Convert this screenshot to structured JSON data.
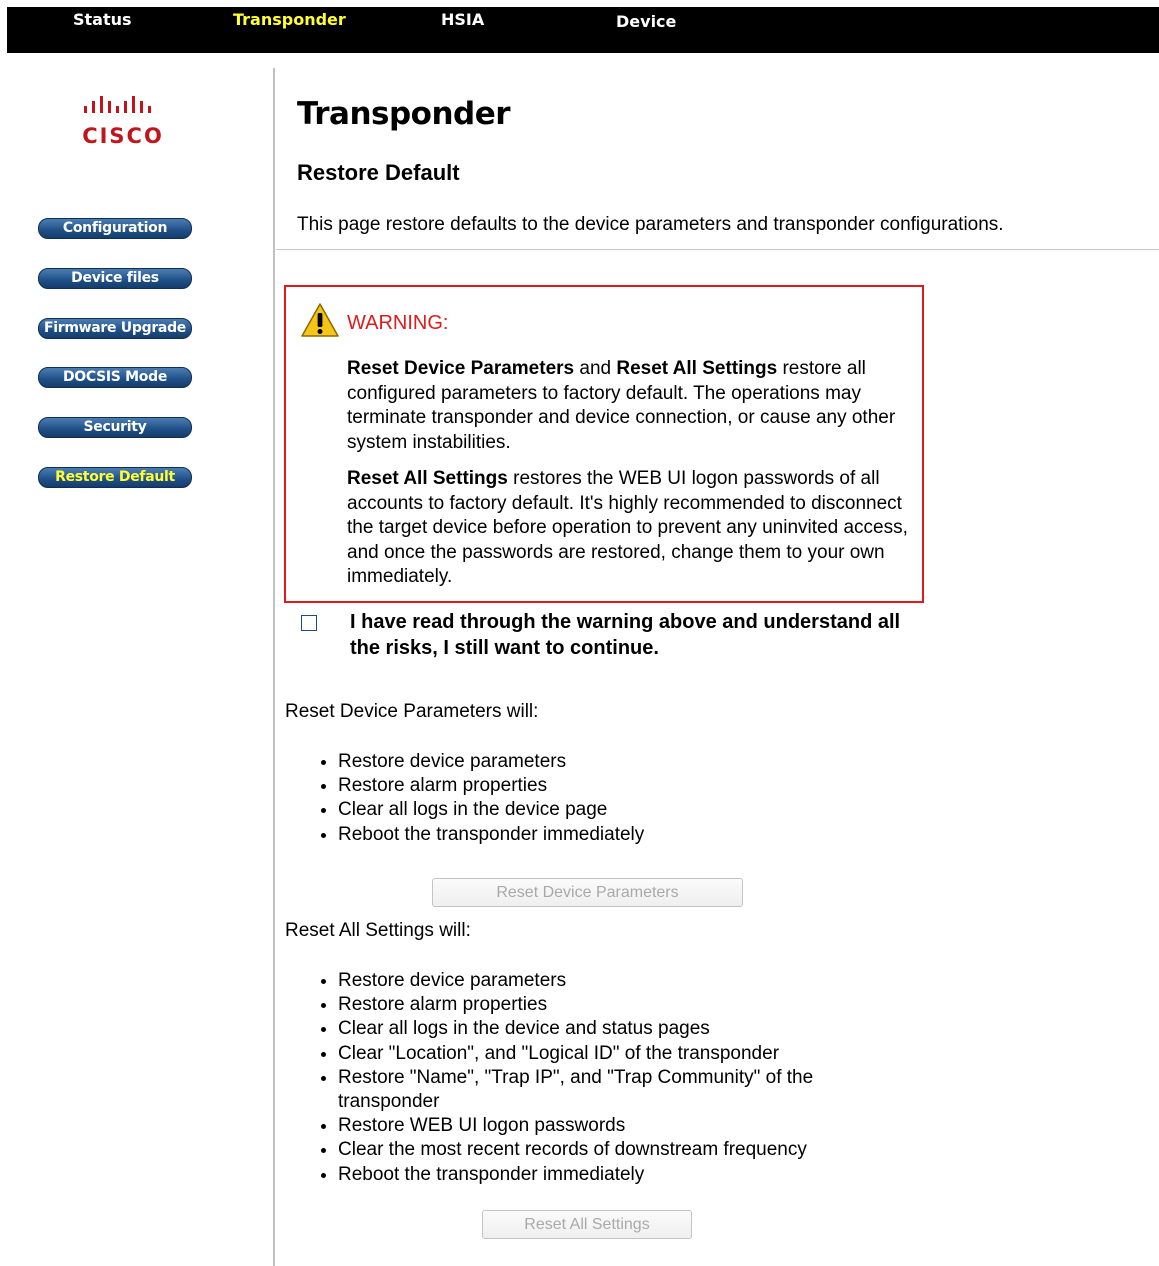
{
  "nav": {
    "items": [
      "Status",
      "Transponder",
      "HSIA",
      "Device"
    ],
    "active": "Transponder"
  },
  "logo": {
    "word": "CISCO"
  },
  "sidebar": {
    "items": [
      "Configuration",
      "Device files",
      "Firmware Upgrade",
      "DOCSIS Mode",
      "Security",
      "Restore Default"
    ],
    "active": "Restore Default"
  },
  "page": {
    "title": "Transponder",
    "subtitle": "Restore Default",
    "description": "This page restore defaults to the device parameters and transponder configurations."
  },
  "warning": {
    "title": "WARNING:",
    "p1_bold_a": "Reset Device Parameters",
    "p1_and": " and ",
    "p1_bold_b": "Reset All Settings",
    "p1_rest": " restore all configured parameters to factory default. The operations may terminate transponder and device connection, or cause any other system instabilities.",
    "p2_bold": "Reset All Settings",
    "p2_rest": " restores the WEB UI logon passwords of all accounts to factory default. It's highly recommended to disconnect the target device before operation to prevent any uninvited access, and once the passwords are restored, change them to your own immediately."
  },
  "acknowledge": {
    "label": "I have read through the warning above and understand all the risks, I still want to continue.",
    "checked": false
  },
  "reset_device": {
    "label": "Reset Device Parameters will:",
    "items": [
      "Restore device parameters",
      "Restore alarm properties",
      "Clear all logs in the device page",
      "Reboot the transponder immediately"
    ],
    "button": "Reset Device Parameters"
  },
  "reset_all": {
    "label": "Reset All Settings will:",
    "items": [
      "Restore device parameters",
      "Restore alarm properties",
      "Clear all logs in the device and status pages",
      "Clear \"Location\", and \"Logical ID\" of the transponder",
      "Restore \"Name\", \"Trap IP\", and \"Trap Community\" of the transponder",
      "Restore WEB UI logon passwords",
      "Clear the most recent records of downstream frequency",
      "Reboot the transponder immediately"
    ],
    "button": "Reset All Settings"
  },
  "colors": {
    "nav_bg": "#000000",
    "active_text": "#ffff33",
    "warning_red": "#e01b1b",
    "button_blue": "#1f4f86",
    "logo_red": "#c0161b"
  }
}
